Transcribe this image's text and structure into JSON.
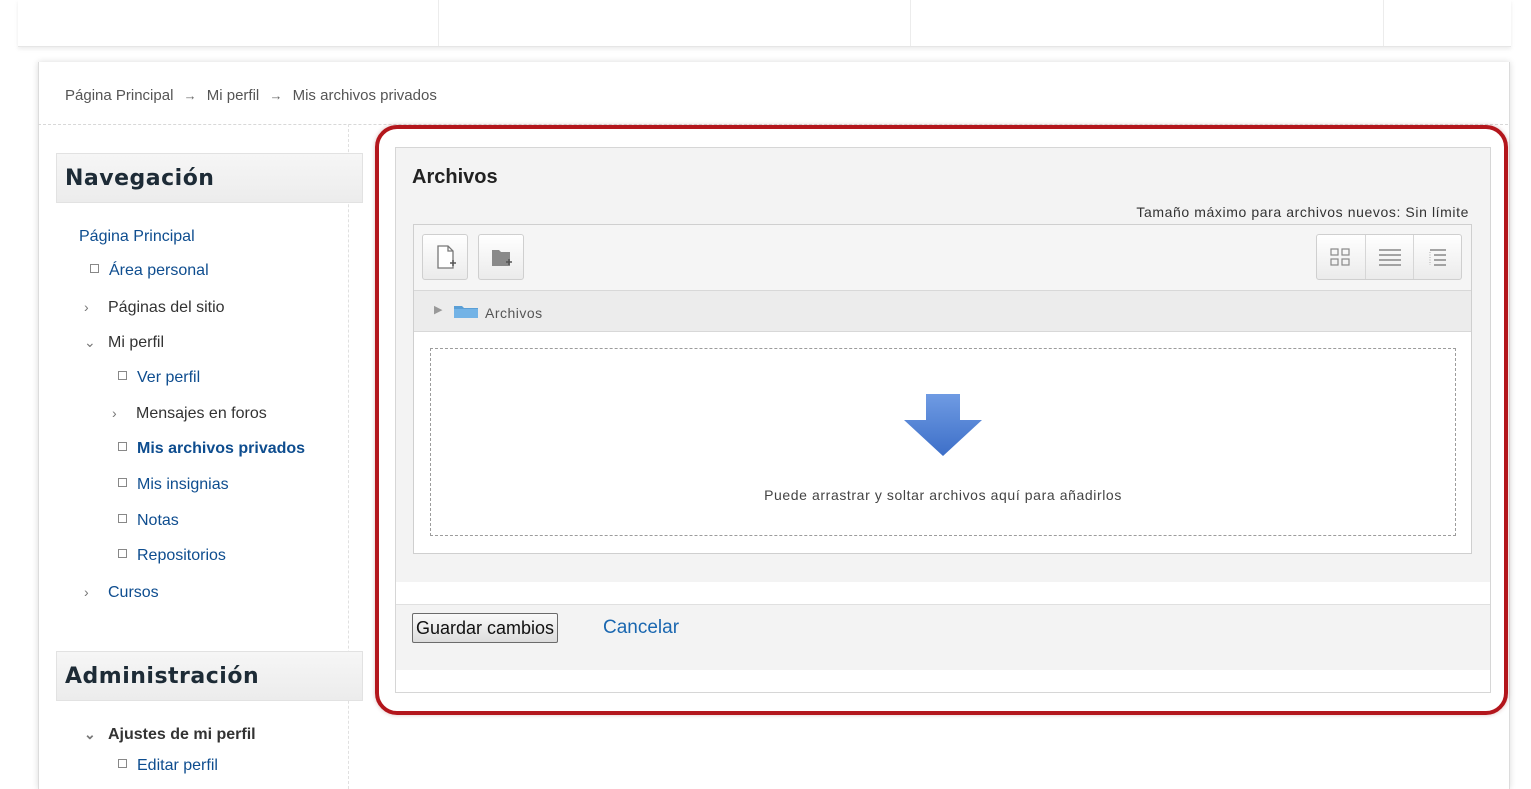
{
  "breadcrumb": {
    "items": [
      "Página Principal",
      "Mi perfil",
      "Mis archivos privados"
    ],
    "separator": "→"
  },
  "sidebar": {
    "navigation_title": "Navegación",
    "nav_items": [
      {
        "label": "Página Principal"
      },
      {
        "label": "Área personal"
      },
      {
        "label": "Páginas del sitio"
      },
      {
        "label": "Mi perfil"
      },
      {
        "label": "Ver perfil"
      },
      {
        "label": "Mensajes en foros"
      },
      {
        "label": "Mis archivos privados"
      },
      {
        "label": "Mis insignias"
      },
      {
        "label": "Notas"
      },
      {
        "label": "Repositorios"
      },
      {
        "label": "Cursos"
      }
    ],
    "admin_title": "Administración",
    "admin_items": [
      {
        "label": "Ajustes de mi perfil"
      },
      {
        "label": "Editar perfil"
      }
    ]
  },
  "files": {
    "title": "Archivos",
    "max_size": "Tamaño máximo para archivos nuevos: Sin límite",
    "path_label": "Archivos",
    "drop_text": "Puede arrastrar y soltar archivos aquí para añadirlos"
  },
  "actions": {
    "save_label": "Guardar cambios",
    "cancel_label": "Cancelar"
  },
  "colors": {
    "highlight": "#b3161c",
    "link": "#0e4d8f",
    "drop_arrow": "#4a7fd1"
  }
}
